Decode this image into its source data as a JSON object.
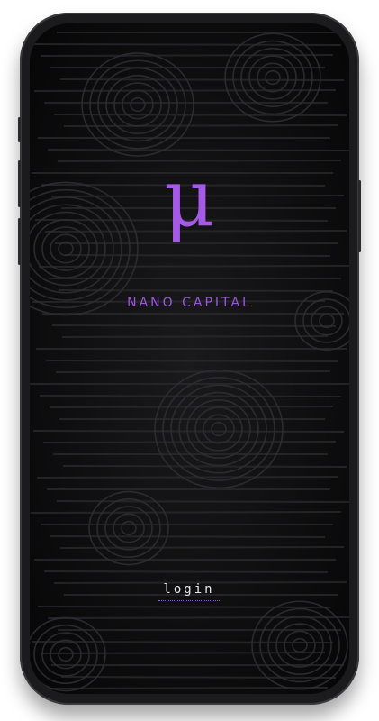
{
  "app": {
    "logo_glyph": "μ",
    "brand_name": "NANO CAPITAL",
    "login_label": "login"
  },
  "colors": {
    "accent": "#a45ae6",
    "background": "#0c0c0d",
    "login_text": "#e6e6e6"
  }
}
